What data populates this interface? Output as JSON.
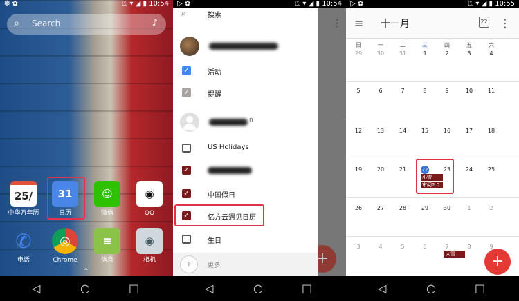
{
  "panel1": {
    "status_left": "❃ ✿",
    "status_right": "⚿ ▾ ◢ ▮ 10:54",
    "search_placeholder": "Search",
    "apps": [
      {
        "label": "中华万年历",
        "icon_text": "25/"
      },
      {
        "label": "日历",
        "icon_text": "31"
      },
      {
        "label": "微信",
        "icon_text": "☺"
      },
      {
        "label": "QQ",
        "icon_text": "◉"
      },
      {
        "label": "电话",
        "icon_text": "✆"
      },
      {
        "label": "Chrome",
        "icon_text": "◎"
      },
      {
        "label": "信息",
        "icon_text": "≡"
      },
      {
        "label": "相机",
        "icon_text": "◉"
      }
    ],
    "dock_arrow": "^"
  },
  "panel2": {
    "status_left": "▷ ✿",
    "status_right": "⚿ ▾ ◢ ▮ 10:54",
    "search_label": "搜索",
    "items": [
      {
        "label": "活动",
        "checked": true,
        "color": "#4285f4"
      },
      {
        "label": "提醒",
        "checked": true,
        "color": "#a8a29e"
      },
      {
        "label": "US Holidays",
        "checked": false,
        "color": "#555555"
      },
      {
        "label": "中国假日",
        "checked": true,
        "color": "#7a1a1a"
      },
      {
        "label": "亿方云遇见日历",
        "checked": true,
        "color": "#7a1a1a"
      },
      {
        "label": "生日",
        "checked": false,
        "color": "#555555"
      }
    ],
    "more_label": "更多",
    "account_suffix": "n"
  },
  "panel3": {
    "status_left": "▷ ✿",
    "status_right": "⚿ ▾ ◢ ▮ 10:55",
    "month_title": "十一月",
    "today_badge": "22",
    "weekdays": [
      "日",
      "一",
      "二",
      "三",
      "四",
      "五",
      "六"
    ],
    "weeks": [
      [
        "29",
        "30",
        "31",
        "1",
        "2",
        "3",
        "4"
      ],
      [
        "5",
        "6",
        "7",
        "8",
        "9",
        "10",
        "11"
      ],
      [
        "12",
        "13",
        "14",
        "15",
        "16",
        "17",
        "18"
      ],
      [
        "19",
        "20",
        "21",
        "22",
        "23",
        "24",
        "25"
      ],
      [
        "26",
        "27",
        "28",
        "29",
        "30",
        "1",
        "2"
      ],
      [
        "3",
        "4",
        "5",
        "6",
        "7",
        "8",
        "9"
      ]
    ],
    "events": [
      {
        "label": "小雪"
      },
      {
        "label": "审阅2.0"
      },
      {
        "label": "大雪"
      }
    ],
    "fab": "+"
  },
  "nav": {
    "back": "◁",
    "home": "○",
    "recent": "□"
  }
}
